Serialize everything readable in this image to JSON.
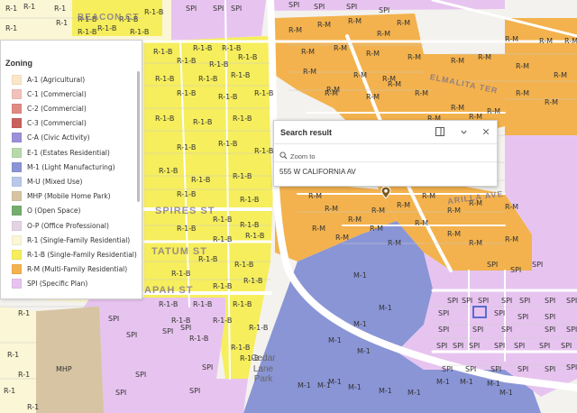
{
  "legend": {
    "title": "Zoning",
    "items": [
      {
        "label": "A-1 (Agricultural)",
        "color": "#fbe6c8"
      },
      {
        "label": "C-1 (Commercial)",
        "color": "#f2c1bb"
      },
      {
        "label": "C-2 (Commercial)",
        "color": "#e08a84"
      },
      {
        "label": "C-3 (Commercial)",
        "color": "#c9615d"
      },
      {
        "label": "C-A (Civic Activity)",
        "color": "#9b8fd9"
      },
      {
        "label": "E-1 (Estates Residential)",
        "color": "#b9d9ab"
      },
      {
        "label": "M-1 (Light Manufacturing)",
        "color": "#8a95d6"
      },
      {
        "label": "M-U (Mixed Use)",
        "color": "#b9c9ea"
      },
      {
        "label": "MHP (Mobile Home Park)",
        "color": "#d7c4a2"
      },
      {
        "label": "O (Open Space)",
        "color": "#76ad6e"
      },
      {
        "label": "O-P (Office Professional)",
        "color": "#e3d3e3"
      },
      {
        "label": "R-1 (Single-Family Residential)",
        "color": "#fbf6d6"
      },
      {
        "label": "R-1-B (Single-Family Residential)",
        "color": "#f6ee5c"
      },
      {
        "label": "R-M (Multi-Family Residential)",
        "color": "#f3b24d"
      },
      {
        "label": "SPI (Specific Plan)",
        "color": "#e7c4ef"
      }
    ]
  },
  "popup": {
    "title": "Search result",
    "zoom_label": "Zoom to",
    "address": "555 W CALIFORNIA AV",
    "icons": [
      "dock-icon",
      "chevron-down-icon",
      "close-icon"
    ]
  },
  "streets": [
    "BEACON CT",
    "SPIRES ST",
    "TATUM ST",
    "APAH ST",
    "ELMALITA TER",
    "ARILLA AVE"
  ],
  "park": "Cedar\nLane\nPark",
  "zones": {
    "r1": "R-1",
    "r1b": "R-1-B",
    "rm": "R-M",
    "spi": "SPI",
    "m1": "M-1",
    "mhp": "MHP"
  }
}
